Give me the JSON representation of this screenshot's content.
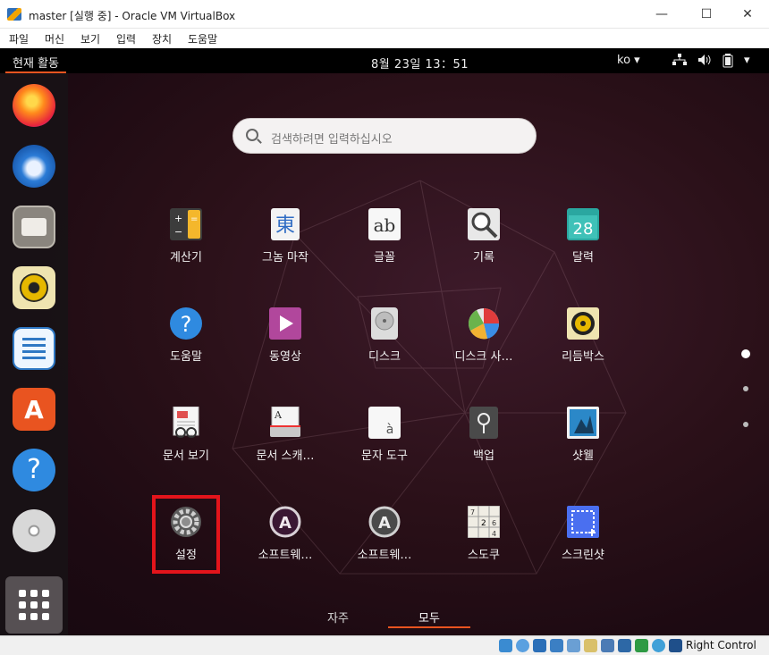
{
  "window": {
    "title": "master [실행 중] - Oracle VM VirtualBox",
    "controls": {
      "minimize": "—",
      "maximize": "☐",
      "close": "✕"
    }
  },
  "menu": [
    "파일",
    "머신",
    "보기",
    "입력",
    "장치",
    "도움말"
  ],
  "topbar": {
    "activities": "현재 활동",
    "clock": "8월 23일  13：51",
    "lang": "ko ▾"
  },
  "search": {
    "placeholder": "검색하려면 입력하십시오"
  },
  "dock": [
    "firefox-icon",
    "thunderbird-icon",
    "files-icon",
    "rhythmbox-icon",
    "libreoffice-writer-icon",
    "software-center-icon",
    "help-icon",
    "disc-icon"
  ],
  "apps": [
    {
      "label": "계산기",
      "icon": "calculator-icon"
    },
    {
      "label": "그놈 마작",
      "icon": "mahjongg-icon",
      "glyph": "東"
    },
    {
      "label": "글꼴",
      "icon": "fonts-icon",
      "glyph": "ab"
    },
    {
      "label": "기록",
      "icon": "logs-icon"
    },
    {
      "label": "달력",
      "icon": "calendar-icon",
      "glyph": "28"
    },
    {
      "label": "도움말",
      "icon": "help-icon",
      "glyph": "?"
    },
    {
      "label": "동영상",
      "icon": "videos-icon"
    },
    {
      "label": "디스크",
      "icon": "disks-icon"
    },
    {
      "label": "디스크 사…",
      "icon": "disk-usage-icon"
    },
    {
      "label": "리듬박스",
      "icon": "rhythmbox-icon"
    },
    {
      "label": "문서 보기",
      "icon": "document-viewer-icon"
    },
    {
      "label": "문서 스캐…",
      "icon": "document-scanner-icon"
    },
    {
      "label": "문자 도구",
      "icon": "characters-icon",
      "glyph": "à"
    },
    {
      "label": "백업",
      "icon": "backup-icon"
    },
    {
      "label": "샷웰",
      "icon": "shotwell-icon"
    },
    {
      "label": "설정",
      "icon": "settings-icon"
    },
    {
      "label": "소프트웨…",
      "icon": "software-icon",
      "glyph": "A"
    },
    {
      "label": "소프트웨…",
      "icon": "software-updater-icon",
      "glyph": "A"
    },
    {
      "label": "스도쿠",
      "icon": "sudoku-icon"
    },
    {
      "label": "스크린샷",
      "icon": "screenshot-icon"
    }
  ],
  "tabs": {
    "frequent": "자주",
    "all": "모두"
  },
  "statusbar": {
    "host_key": "Right Control"
  },
  "colors": {
    "accent": "#e95420",
    "highlight": "#e3141b"
  }
}
